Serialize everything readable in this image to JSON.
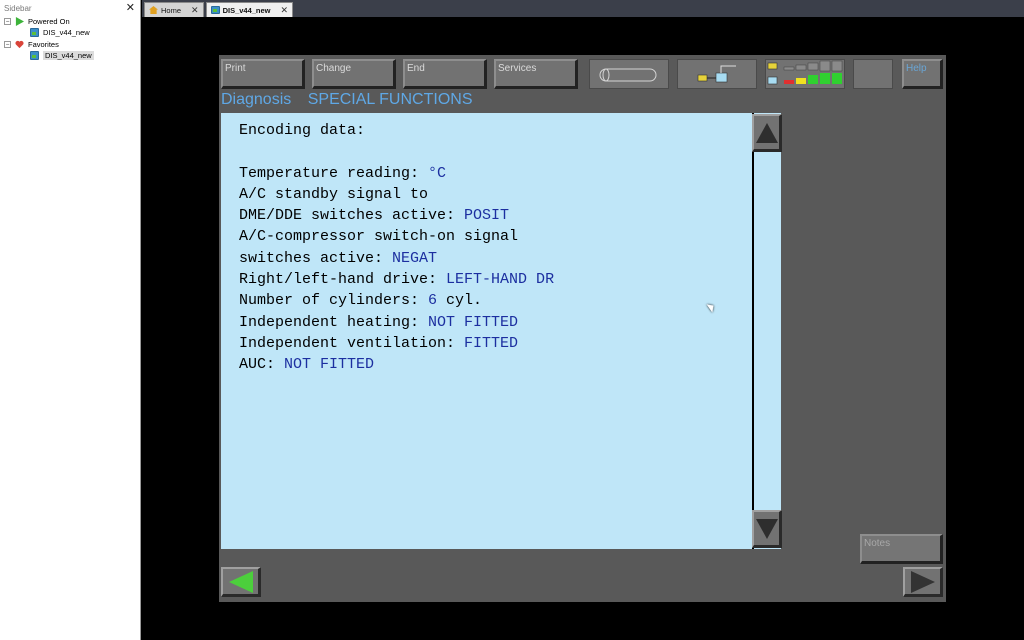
{
  "sidebar": {
    "title": "Sidebar",
    "close_glyph": "✕",
    "tree": [
      {
        "label": "Powered On",
        "icon": "play-icon",
        "toggle": "−"
      },
      {
        "label": "DIS_v44_new",
        "icon": "vm-icon"
      },
      {
        "label": "Favorites",
        "icon": "heart-icon",
        "toggle": "−"
      },
      {
        "label": "DIS_v44_new",
        "icon": "vm-icon"
      }
    ]
  },
  "tabs": [
    {
      "label": "Home",
      "icon": "home-icon",
      "close": "✕"
    },
    {
      "label": "DIS_v44_new",
      "icon": "vm-icon",
      "close": "✕"
    }
  ],
  "dis": {
    "buttons": {
      "print": "Print",
      "change": "Change",
      "end": "End",
      "services": "Services",
      "help": "Help",
      "notes": "Notes"
    },
    "title_left": "Diagnosis",
    "title_right": "SPECIAL FUNCTIONS",
    "lines": [
      {
        "label": "Encoding data:",
        "value": ""
      },
      {
        "label": "",
        "value": ""
      },
      {
        "label": "Temperature reading: ",
        "value": "°C"
      },
      {
        "label": "A/C standby signal to",
        "value": ""
      },
      {
        "label": "DME/DDE switches active: ",
        "value": "POSIT"
      },
      {
        "label": "A/C-compressor switch-on signal",
        "value": ""
      },
      {
        "label": "switches active: ",
        "value": "NEGAT"
      },
      {
        "label": "Right/left-hand drive: ",
        "value": "LEFT-HAND DR"
      },
      {
        "label": "Number of cylinders: ",
        "value": "6",
        "suffix": " cyl."
      },
      {
        "label": "Independent heating: ",
        "value": "NOT FITTED"
      },
      {
        "label": "Independent ventilation: ",
        "value": "FITTED"
      },
      {
        "label": "AUC: ",
        "value": "NOT FITTED"
      }
    ],
    "colors": {
      "content_bg": "#bfe6f8",
      "value_text": "#1c2fa0",
      "title_text": "#5fa8e6",
      "frame": "#595959"
    }
  }
}
